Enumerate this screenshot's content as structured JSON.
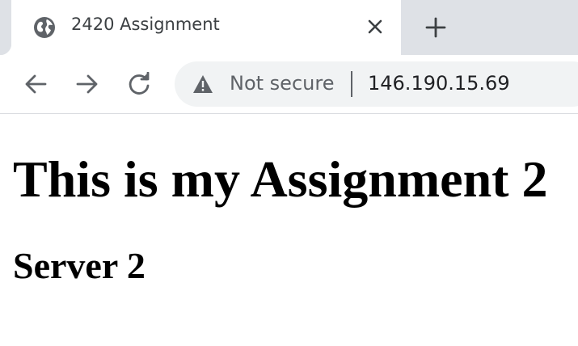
{
  "tab": {
    "title": "2420 Assignment",
    "favicon": "globe-icon"
  },
  "toolbar": {
    "back_icon": "back-arrow-icon",
    "forward_icon": "forward-arrow-icon",
    "reload_icon": "reload-icon"
  },
  "omnibox": {
    "security_label": "Not secure",
    "url": "146.190.15.69"
  },
  "page": {
    "heading": "This is my Assignment 2",
    "subheading": "Server 2"
  },
  "colors": {
    "tabstrip": "#dee1e6",
    "omnibox_bg": "#f1f3f4",
    "icon": "#5f6368",
    "text": "#000000"
  }
}
